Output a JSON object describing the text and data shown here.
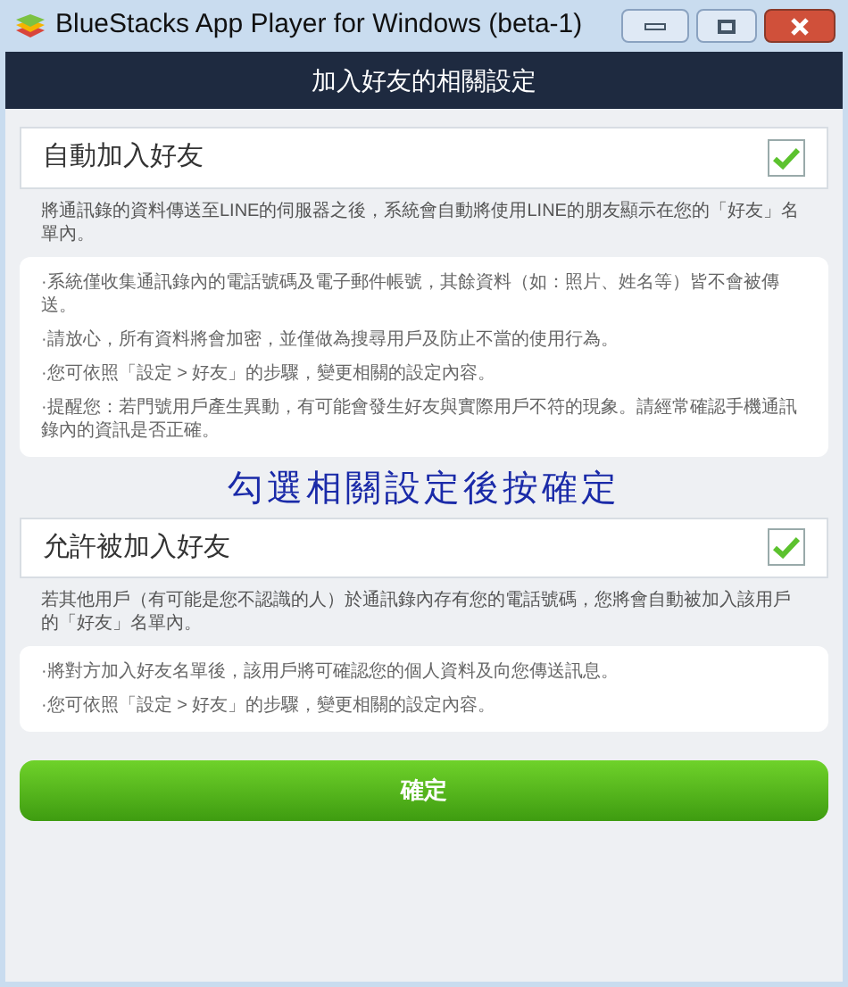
{
  "window": {
    "title": "BlueStacks App Player for Windows (beta-1)"
  },
  "header": {
    "title": "加入好友的相關設定"
  },
  "sections": [
    {
      "label": "自動加入好友",
      "checked": true,
      "description": "將通訊錄的資料傳送至LINE的伺服器之後，系統會自動將使用LINE的朋友顯示在您的「好友」名單內。",
      "notes": [
        "·系統僅收集通訊錄內的電話號碼及電子郵件帳號，其餘資料（如：照片、姓名等）皆不會被傳送。",
        "·請放心，所有資料將會加密，並僅做為搜尋用戶及防止不當的使用行為。",
        "·您可依照「設定 > 好友」的步驟，變更相關的設定內容。",
        "·提醒您：若門號用戶產生異動，有可能會發生好友與實際用戶不符的現象。請經常確認手機通訊錄內的資訊是否正確。"
      ]
    },
    {
      "label": "允許被加入好友",
      "checked": true,
      "description": "若其他用戶（有可能是您不認識的人）於通訊錄內存有您的電話號碼，您將會自動被加入該用戶的「好友」名單內。",
      "notes": [
        "·將對方加入好友名單後，該用戶將可確認您的個人資料及向您傳送訊息。",
        "·您可依照「設定 > 好友」的步驟，變更相關的設定內容。"
      ]
    }
  ],
  "annotation": "勾選相關設定後按確定",
  "confirm_button": "確定"
}
